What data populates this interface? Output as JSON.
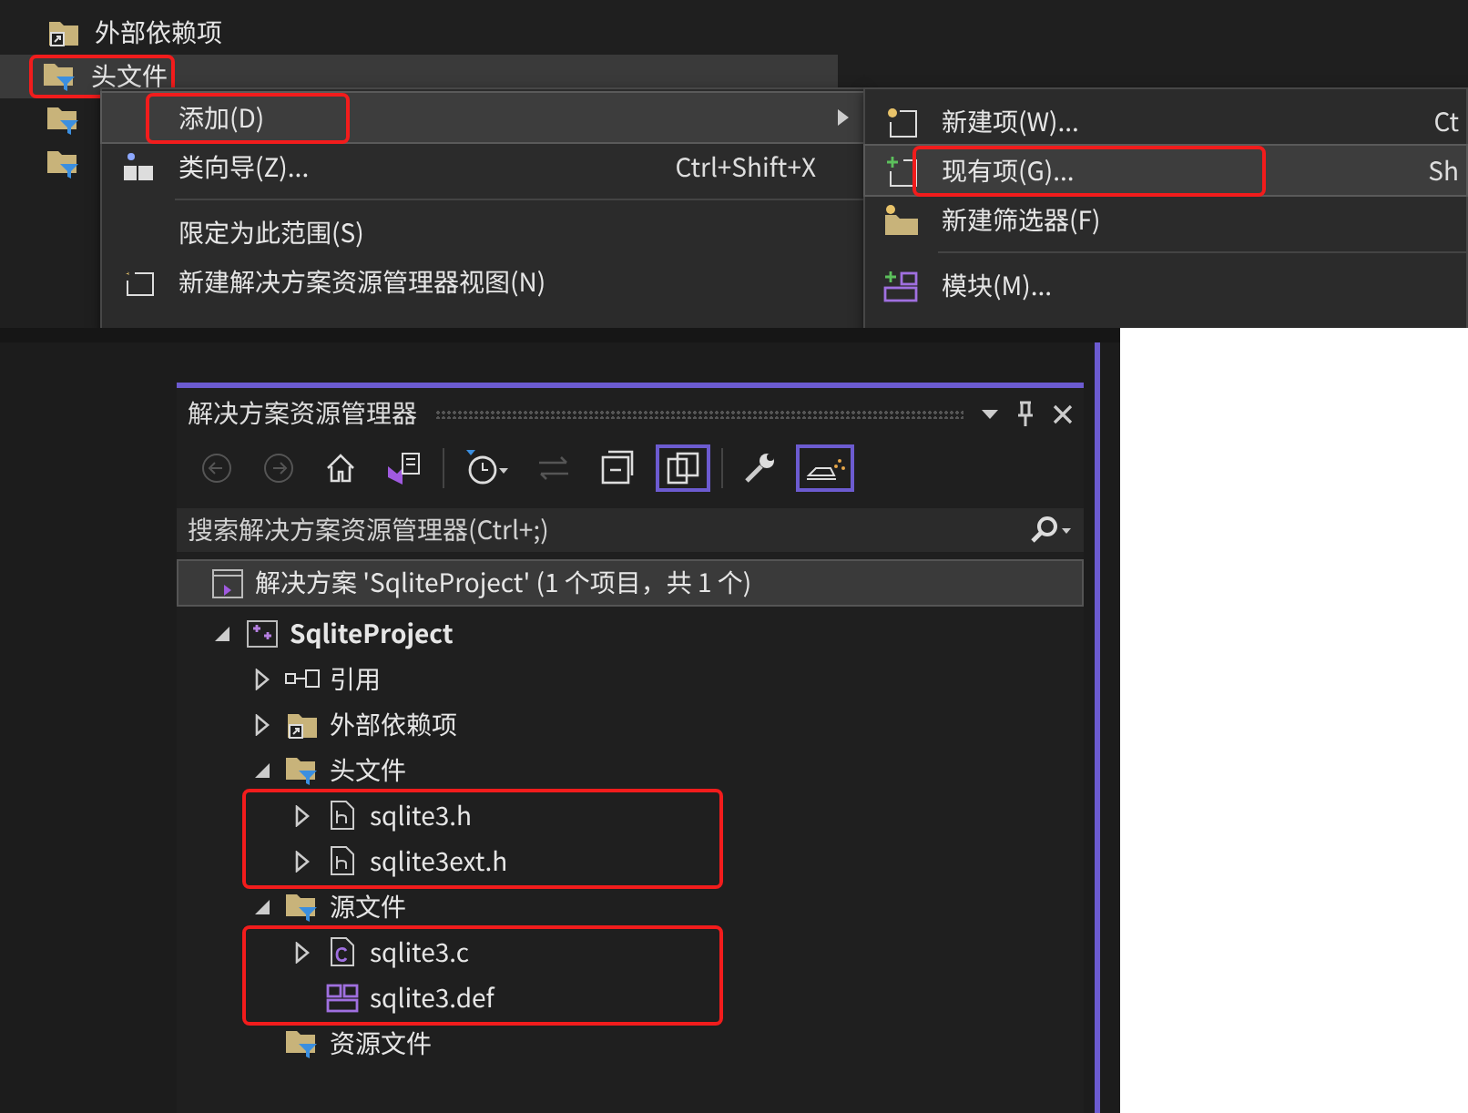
{
  "top_view": {
    "tree": [
      {
        "kind": "external",
        "label": "外部依赖项",
        "selected": false,
        "annotated": false
      },
      {
        "kind": "filter",
        "label": "头文件",
        "selected": true,
        "annotated": true
      },
      {
        "kind": "filter",
        "selected": false,
        "annotated": false
      },
      {
        "kind": "filter",
        "selected": false,
        "annotated": false
      }
    ],
    "context_menu": [
      {
        "kind": "plain",
        "label": "添加(D)",
        "submenu": true,
        "selected": true,
        "annotated": true
      },
      {
        "kind": "class_wizard",
        "label": "类向导(Z)...",
        "shortcut": "Ctrl+Shift+X",
        "submenu": false,
        "selected": false,
        "annotated": false
      },
      {
        "kind": "separator"
      },
      {
        "kind": "plain",
        "label": "限定为此范围(S)",
        "submenu": false,
        "selected": false,
        "annotated": false
      },
      {
        "kind": "new_view",
        "label": "新建解决方案资源管理器视图(N)",
        "submenu": false,
        "selected": false,
        "annotated": false
      }
    ],
    "submenu": [
      {
        "kind": "new_item",
        "label": "新建项(W)...",
        "shortcut": "Ct",
        "selected": false,
        "annotated": false
      },
      {
        "kind": "existing_item",
        "label": "现有项(G)...",
        "shortcut": "Sh",
        "selected": true,
        "annotated": true
      },
      {
        "kind": "new_filter",
        "label": "新建筛选器(F)",
        "selected": false,
        "annotated": false
      },
      {
        "kind": "separator"
      },
      {
        "kind": "module",
        "label": "模块(M)...",
        "selected": false,
        "annotated": false
      }
    ]
  },
  "solution_explorer": {
    "title": "解决方案资源管理器",
    "toolbar": [
      {
        "kind": "back",
        "on": false
      },
      {
        "kind": "forward",
        "on": false
      },
      {
        "kind": "home",
        "on": false
      },
      {
        "kind": "switch_views",
        "on": false
      },
      {
        "kind": "divider"
      },
      {
        "kind": "pending_changes",
        "on": false
      },
      {
        "kind": "sync",
        "on": false
      },
      {
        "kind": "collapse_all",
        "on": false
      },
      {
        "kind": "show_all",
        "on": true
      },
      {
        "kind": "divider"
      },
      {
        "kind": "properties",
        "on": false
      },
      {
        "kind": "preview",
        "on": true
      }
    ],
    "search": {
      "placeholder": "搜索解决方案资源管理器(Ctrl+;)"
    },
    "solution": "解决方案 'SqliteProject' (1 个项目，共 1 个)",
    "tree": [
      {
        "kind": "project",
        "label": "SqliteProject",
        "expanded": true,
        "children": [
          {
            "kind": "reference",
            "label": "引用",
            "expanded": false
          },
          {
            "kind": "external",
            "label": "外部依赖项",
            "expanded": false
          },
          {
            "kind": "filter",
            "label": "头文件",
            "expanded": true,
            "annotated": true,
            "children": [
              {
                "kind": "header",
                "label": "sqlite3.h",
                "expanded": false
              },
              {
                "kind": "header",
                "label": "sqlite3ext.h",
                "expanded": false
              }
            ]
          },
          {
            "kind": "filter",
            "label": "源文件",
            "expanded": true,
            "annotated": true,
            "children": [
              {
                "kind": "c_file",
                "label": "sqlite3.c",
                "expanded": false
              },
              {
                "kind": "def_file",
                "label": "sqlite3.def"
              }
            ]
          },
          {
            "kind": "filter",
            "label": "资源文件"
          }
        ]
      }
    ]
  }
}
